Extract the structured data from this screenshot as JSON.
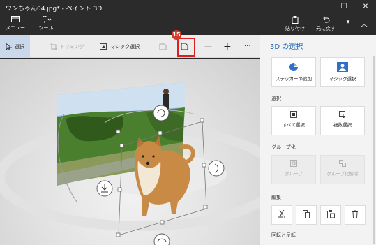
{
  "window": {
    "title": "ワンちゃん04.jpg* - ペイント 3D",
    "minimize_glyph": "─",
    "maximize_glyph": "☐",
    "close_glyph": "✕"
  },
  "ribbon": {
    "menu_label": "メニュー",
    "tools_label": "ツール",
    "paste_label": "貼り付け",
    "undo_label": "元に戻す",
    "redo_glyph": "▾",
    "collapse_glyph": "︿"
  },
  "toolbar": {
    "select_label": "選択",
    "trim_label": "トリミング",
    "magic_select_label": "マジック選択",
    "minus_glyph": "—",
    "plus_glyph": "+",
    "more_glyph": "···",
    "step_badge": "15",
    "highlight_color": "#e02020"
  },
  "panel": {
    "title": "3D の選択",
    "add_sticker_label": "ステッカーの追加",
    "magic_select_label": "マジック選択",
    "select_section": "選択",
    "select_all_label": "すべて選択",
    "multi_select_label": "複数選択",
    "group_section": "グループ化",
    "group_label": "グループ",
    "ungroup_label": "グループ化解除",
    "edit_section": "編集",
    "rotate_section": "回転と反転",
    "accent_color": "#1a63b7"
  },
  "icons": [
    "menu-icon",
    "tools-icon",
    "paste-icon",
    "undo-icon",
    "select-icon",
    "trim-icon",
    "magic-select-icon",
    "sticker-icon",
    "canvas-icon",
    "cut-icon",
    "copy-icon",
    "paste-small-icon",
    "delete-icon"
  ]
}
